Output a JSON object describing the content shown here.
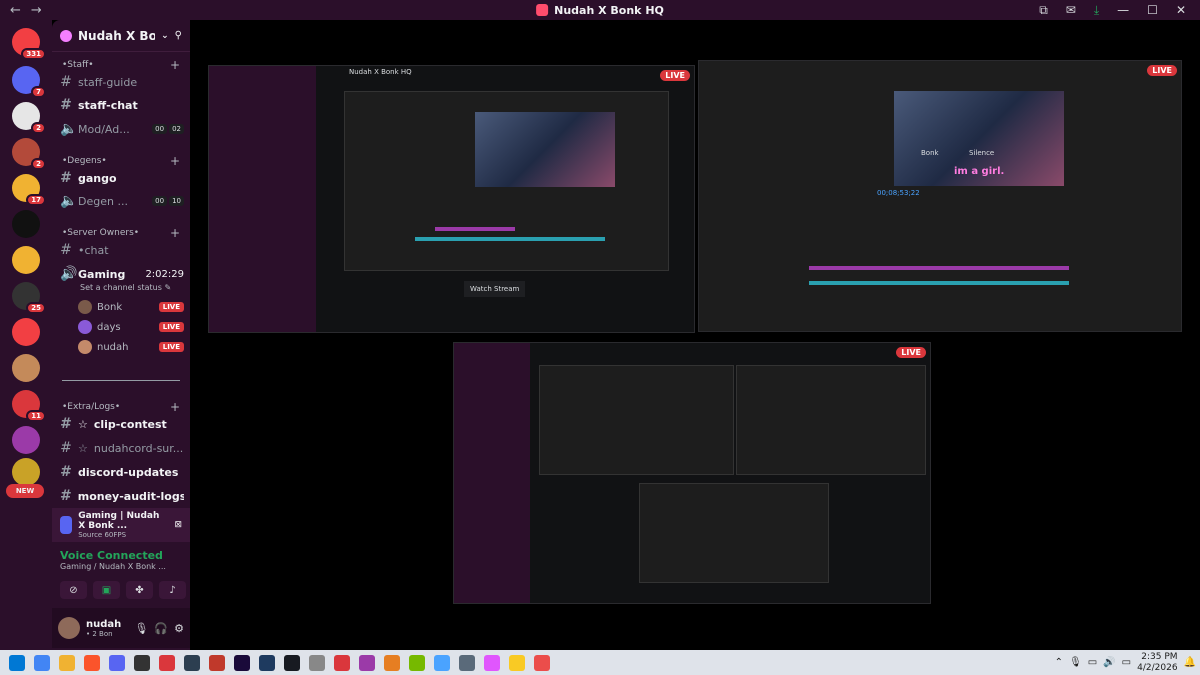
{
  "titlebar": {
    "title": "Nudah X Bonk HQ",
    "back": "←",
    "forward": "→"
  },
  "rail": {
    "servers": [
      {
        "name": "discord-home",
        "badge": "331",
        "color": "#f23f43"
      },
      {
        "name": "server-1",
        "badge": "7",
        "color": "#5865f2"
      },
      {
        "name": "server-2",
        "badge": "2",
        "color": "#e6e6e6"
      },
      {
        "name": "server-3",
        "badge": "2",
        "color": "#b34a3a"
      },
      {
        "name": "server-4",
        "badge": "17",
        "color": "#f0b232"
      },
      {
        "name": "server-5",
        "badge": "",
        "color": "#111"
      },
      {
        "name": "server-6",
        "badge": "",
        "color": "#f0b232"
      },
      {
        "name": "server-7",
        "badge": "25",
        "color": "#333"
      },
      {
        "name": "server-8",
        "badge": "",
        "color": "#f23f43"
      },
      {
        "name": "server-9",
        "badge": "",
        "color": "#c48a5a"
      },
      {
        "name": "server-10",
        "badge": "11",
        "color": "#da373c"
      },
      {
        "name": "server-11",
        "badge": "",
        "color": "#9b3aa8"
      },
      {
        "name": "server-12",
        "badge": "",
        "color": "#c9a227"
      }
    ],
    "new_label": "NEW"
  },
  "sidebar": {
    "guild_name": "Nudah X Bo...",
    "staff_cat": "•Staff•",
    "staff_guide": "staff-guide",
    "staff_chat": "staff-chat",
    "mod_admin": "Mod/Ad...",
    "mod_meta_1": "00",
    "mod_meta_2": "02",
    "degens_cat": "•Degens•",
    "gango": "gango",
    "degen_vc": "Degen ...",
    "degen_meta_1": "00",
    "degen_meta_2": "10",
    "owners_cat": "•Server Owners•",
    "chat": "•chat",
    "gaming": "Gaming",
    "gaming_time": "2:02:29",
    "status_prompt": "Set a channel status",
    "vc_users": [
      {
        "name": "Bonk",
        "live": "LIVE",
        "color": "#7a5a4a"
      },
      {
        "name": "days",
        "live": "LIVE",
        "color": "#8a5ad8"
      },
      {
        "name": "nudah",
        "live": "LIVE",
        "color": "#c48a6a"
      }
    ],
    "extra_cat": "•Extra/Logs•",
    "clip_contest": "clip-contest",
    "nudahcord": "nudahcord-sur...",
    "discord_updates": "discord-updates",
    "money_audit": "money-audit-logs"
  },
  "activity": {
    "title": "Gaming | Nudah X Bonk ...",
    "sub": "Source 60FPS"
  },
  "voice": {
    "status": "Voice Connected",
    "sub": "Gaming / Nudah X Bonk ..."
  },
  "user": {
    "name": "nudah",
    "sub": "• 2 Bon"
  },
  "stream": {
    "live_label": "LIVE",
    "tile1_title": "Nudah X Bonk HQ",
    "watch_stream": "Watch Stream",
    "caption_left": "Bonk",
    "caption_right": "Silence",
    "caption_main": "im a girl.",
    "timecode": "00;08;53;22"
  },
  "taskbar": {
    "time": "2:35 PM",
    "date": "4/2/2026"
  }
}
